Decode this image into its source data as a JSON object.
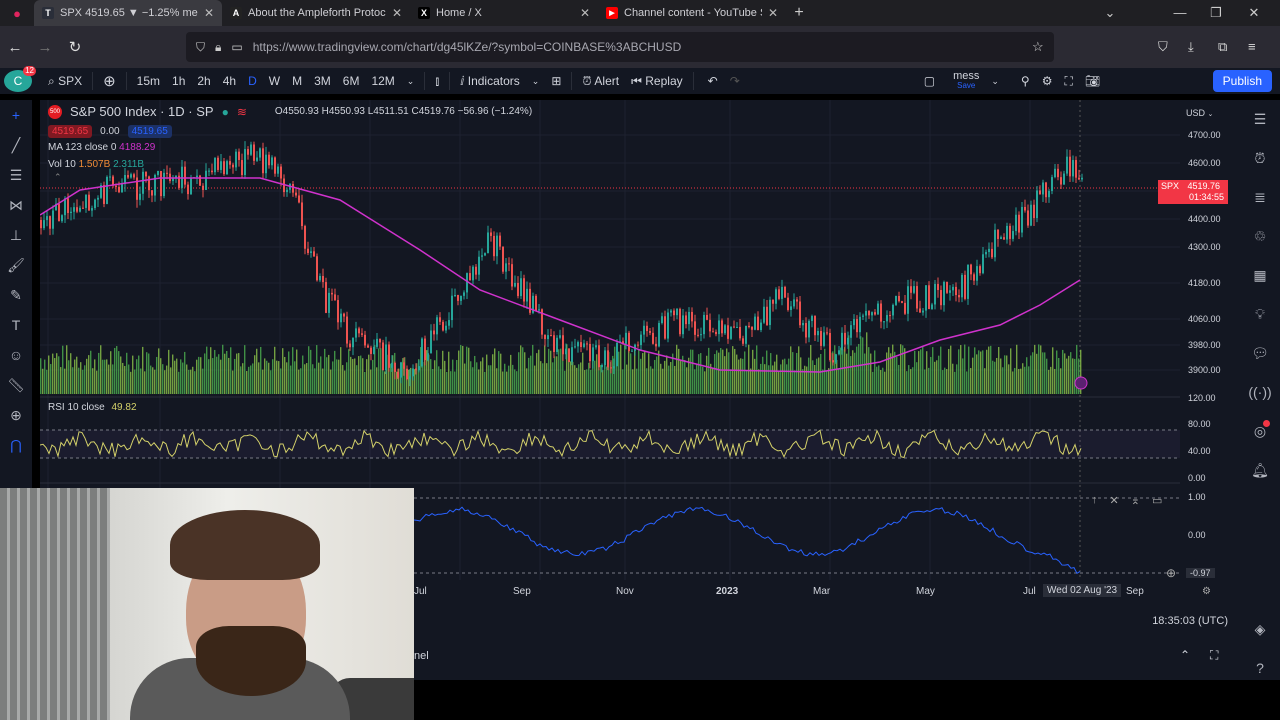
{
  "browser": {
    "tabs": [
      {
        "title": "SPX 4519.65 ▼ −1.25% mess",
        "favicon": "T",
        "favcolor": "#2a2e39",
        "active": true
      },
      {
        "title": "About the Ampleforth Protocol",
        "favicon": "A",
        "favcolor": "#222",
        "active": false
      },
      {
        "title": "Home / X",
        "favicon": "X",
        "favcolor": "#000",
        "active": false
      },
      {
        "title": "Channel content - YouTube Studio",
        "favicon": "▶",
        "favcolor": "#ff0000",
        "active": false
      }
    ],
    "url": "https://www.tradingview.com/chart/dg45lKZe/?symbol=COINBASE%3ABCHUSD"
  },
  "toolbar": {
    "symbol": "SPX",
    "intervals": [
      "15m",
      "1h",
      "2h",
      "4h",
      "D",
      "W",
      "M",
      "3M",
      "6M",
      "12M"
    ],
    "selected_interval": "D",
    "indicators_label": "Indicators",
    "alert_label": "Alert",
    "replay_label": "Replay",
    "layout_name": "mess",
    "layout_sub": "Save",
    "publish_label": "Publish"
  },
  "legend": {
    "title": "S&P 500 Index · 1D · SP",
    "o": "O4550.93",
    "h": "H4550.93",
    "l": "L4511.51",
    "c": "C4519.76",
    "chg": "−56.96 (−1.24%)",
    "bid": "4519.65",
    "spread": "0.00",
    "ask": "4519.65",
    "ma": "MA 123 close 0",
    "ma_val": "4188.29",
    "vol": "Vol 10",
    "vol_a": "1.507B",
    "vol_b": "2.311B"
  },
  "price_axis": {
    "currency": "USD",
    "ticks": [
      "4700.00",
      "4600.00",
      "4519.76",
      "4400.00",
      "4300.00",
      "4180.00",
      "4060.00",
      "3980.00",
      "3900.00"
    ],
    "last_label": "SPX",
    "last_price": "4519.76",
    "countdown": "01:34:55"
  },
  "rsi": {
    "label": "RSI 10 close",
    "value": "49.82",
    "ticks": [
      "120.00",
      "80.00",
      "40.00",
      "0.00"
    ]
  },
  "osc": {
    "ticks": [
      "1.00",
      "0.00",
      "-0.97"
    ]
  },
  "time_axis": {
    "ticks": [
      "Jul",
      "Sep",
      "Nov",
      "2023",
      "Mar",
      "May",
      "Jul",
      "Sep"
    ],
    "crosshair": "Wed 02 Aug '23"
  },
  "bottom": {
    "clock": "18:35:03 (UTC)",
    "tab_partial": "nel"
  }
}
